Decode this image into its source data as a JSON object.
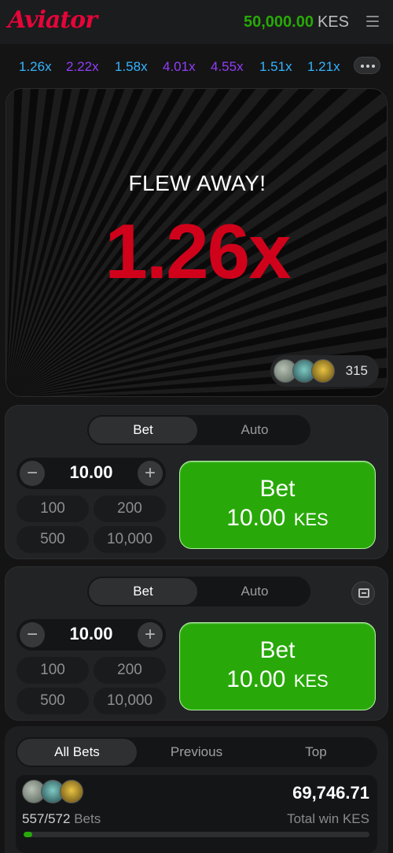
{
  "header": {
    "logo": "Aviator",
    "balance": "50,000.00",
    "currency": "KES"
  },
  "history": [
    {
      "value": "1.26x",
      "color": "#34b4ff"
    },
    {
      "value": "2.22x",
      "color": "#913ef8"
    },
    {
      "value": "1.58x",
      "color": "#34b4ff"
    },
    {
      "value": "4.01x",
      "color": "#913ef8"
    },
    {
      "value": "4.55x",
      "color": "#913ef8"
    },
    {
      "value": "1.51x",
      "color": "#34b4ff"
    },
    {
      "value": "1.21x",
      "color": "#34b4ff"
    }
  ],
  "game": {
    "status": "FLEW AWAY!",
    "multiplier": "1.26x",
    "players_count": "315"
  },
  "bet_panels": [
    {
      "tabs": [
        "Bet",
        "Auto"
      ],
      "stake": "10.00",
      "minus": "−",
      "plus": "+",
      "quick_amounts": [
        "100",
        "200",
        "500",
        "10,000"
      ],
      "bet_label": "Bet",
      "bet_amount": "10.00",
      "bet_currency": "KES"
    },
    {
      "tabs": [
        "Bet",
        "Auto"
      ],
      "stake": "10.00",
      "minus": "−",
      "plus": "+",
      "quick_amounts": [
        "100",
        "200",
        "500",
        "10,000"
      ],
      "bet_label": "Bet",
      "bet_amount": "10.00",
      "bet_currency": "KES"
    }
  ],
  "bets": {
    "tabs": [
      "All Bets",
      "Previous",
      "Top"
    ],
    "bets_count": "557/572",
    "bets_word": "Bets",
    "total_win": "69,746.71",
    "total_win_label": "Total win KES",
    "progress_fraction": 0.026
  },
  "colors": {
    "accent_red": "#e50539",
    "green": "#28a909",
    "crash_red": "#d0021b"
  }
}
